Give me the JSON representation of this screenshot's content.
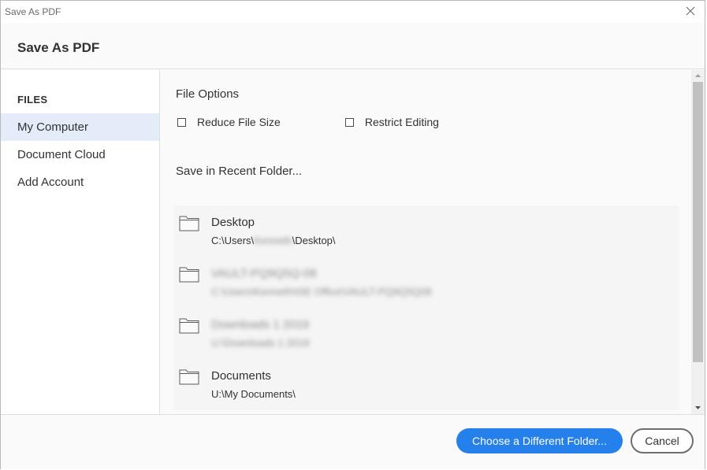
{
  "window": {
    "title": "Save As PDF"
  },
  "header": {
    "title": "Save As PDF"
  },
  "sidebar": {
    "section_label": "FILES",
    "items": [
      {
        "label": "My Computer",
        "selected": true
      },
      {
        "label": "Document Cloud",
        "selected": false
      },
      {
        "label": "Add Account",
        "selected": false
      }
    ]
  },
  "main": {
    "file_options_title": "File Options",
    "options": [
      {
        "label": "Reduce File Size",
        "checked": false
      },
      {
        "label": "Restrict Editing",
        "checked": false
      }
    ],
    "recent_title": "Save in Recent Folder...",
    "folders": [
      {
        "name": "Desktop",
        "path_prefix": "C:\\Users\\",
        "path_redacted": "Kenneth",
        "path_suffix": "\\Desktop\\"
      },
      {
        "name": "VAULT-PQ9Q5Q-08",
        "path": "C:\\Users\\Kenneth\\ISE Office\\VAULT-PQ9Q5Q08",
        "redacted": true
      },
      {
        "name": "Downloads 1 2019",
        "path": "U:\\Downloads 1 2019",
        "redacted": true
      },
      {
        "name": "Documents",
        "path": "U:\\My Documents\\"
      }
    ]
  },
  "footer": {
    "primary_label": "Choose a Different Folder...",
    "cancel_label": "Cancel"
  },
  "icons": {
    "close": "close-icon",
    "folder": "folder-icon",
    "scroll_up": "scroll-up-arrow-icon",
    "scroll_down": "scroll-down-arrow-icon"
  },
  "colors": {
    "accent": "#2680eb",
    "selected_row": "#e3ecf8"
  }
}
